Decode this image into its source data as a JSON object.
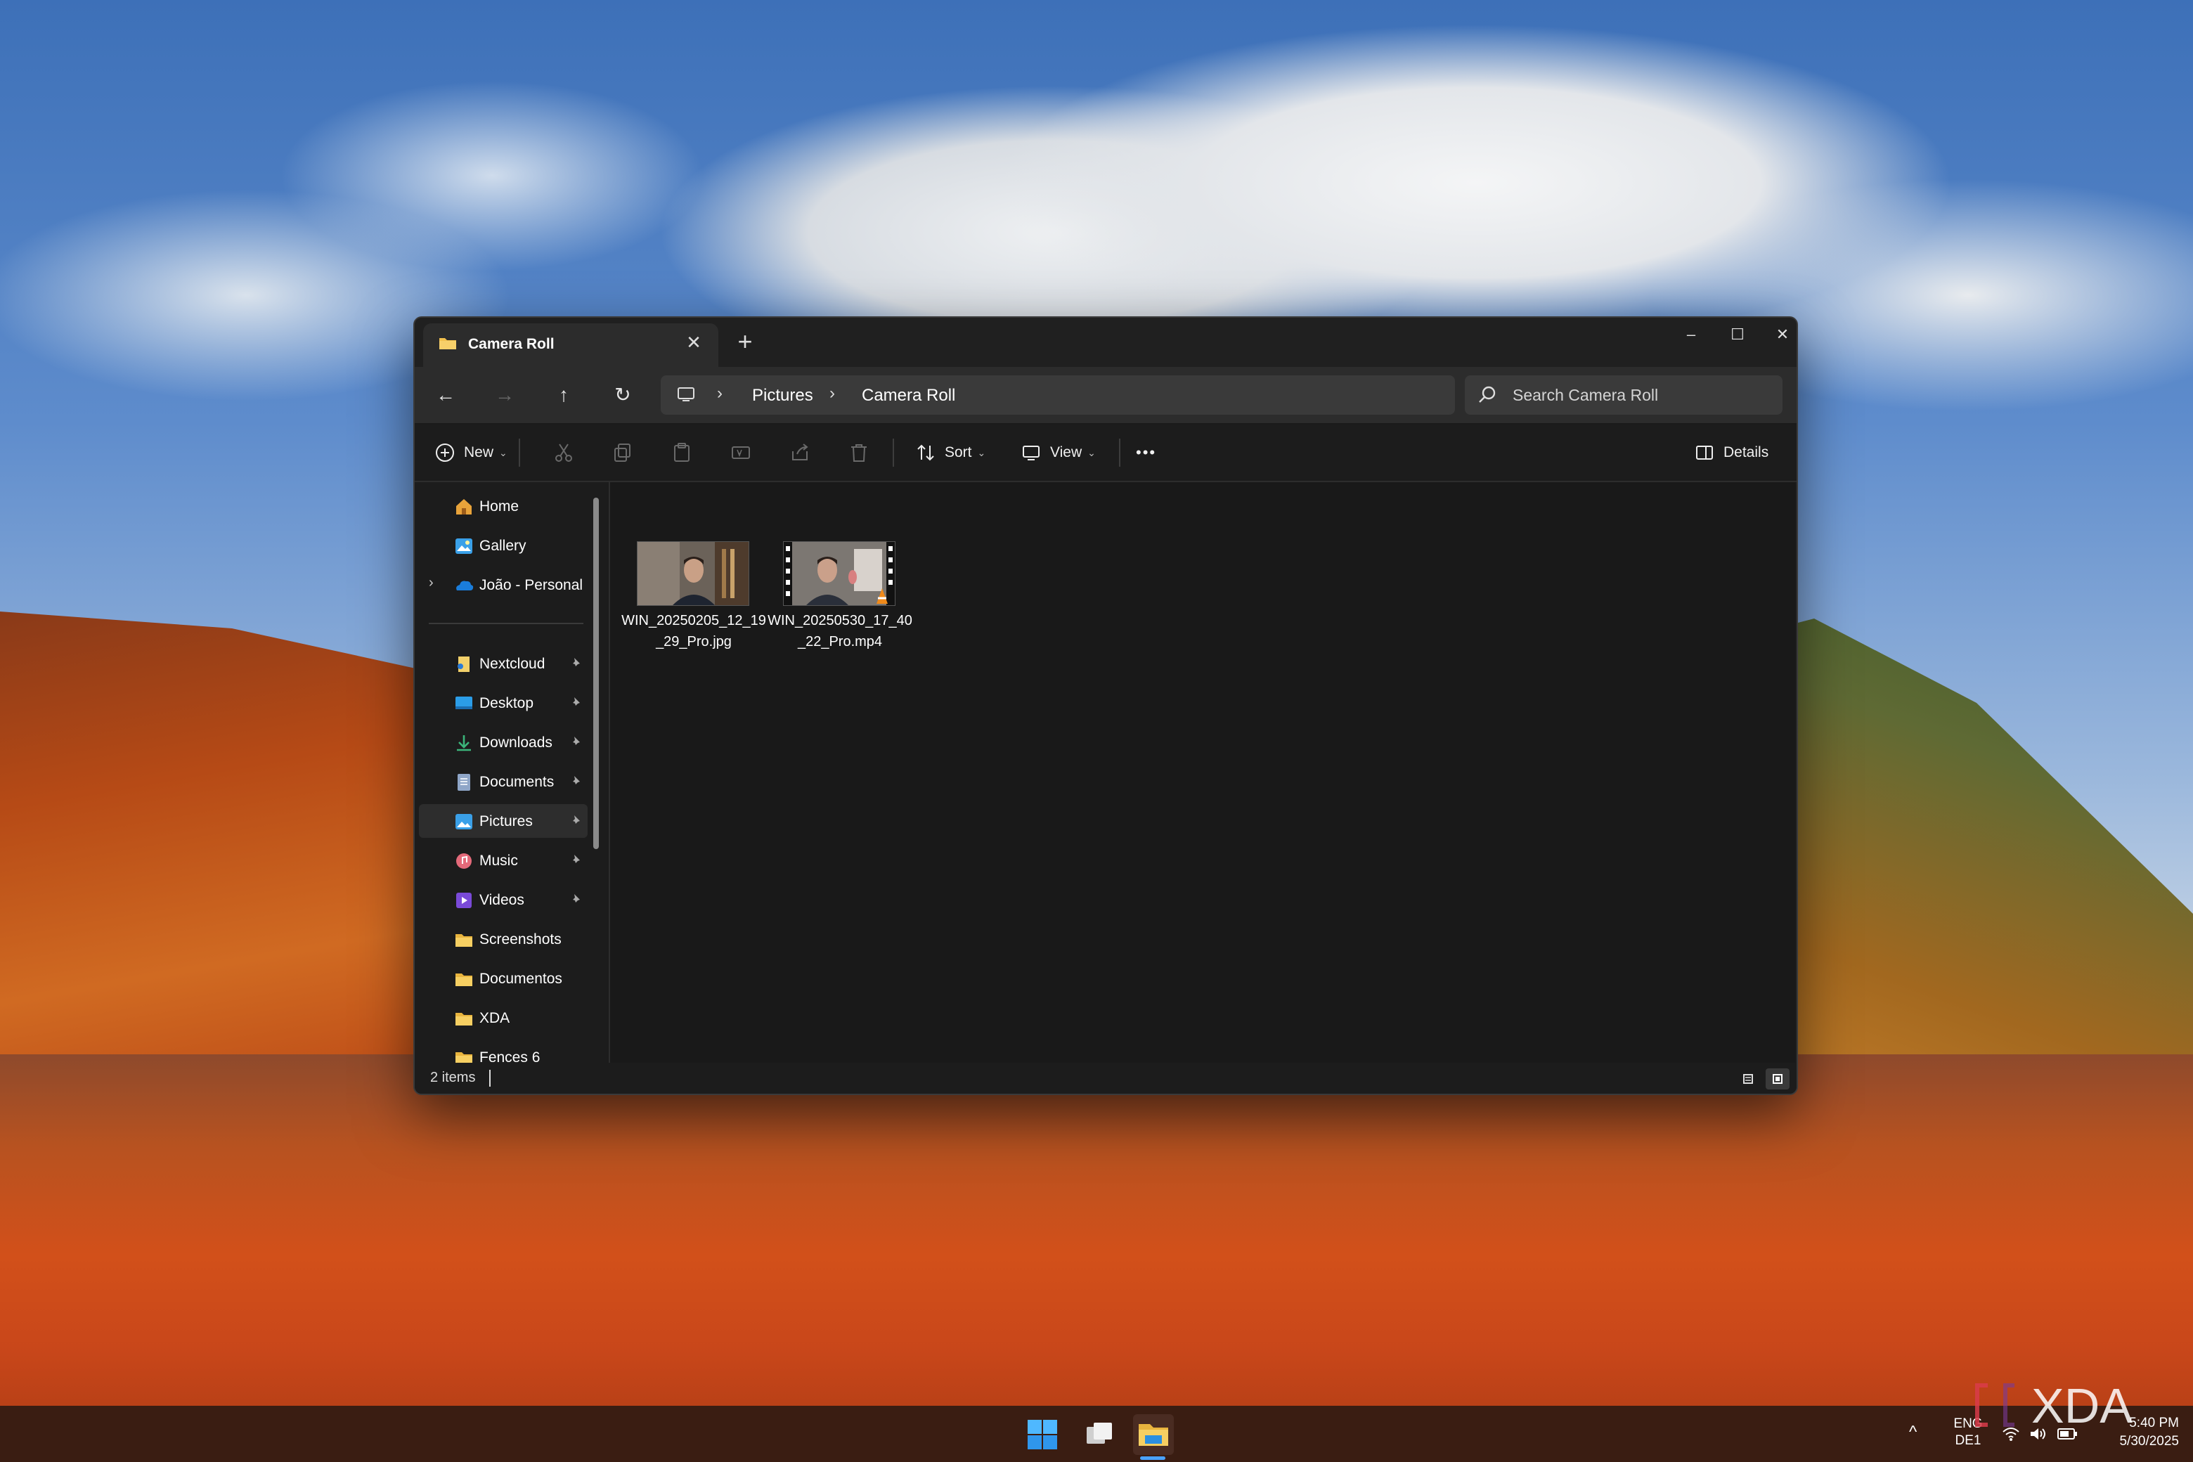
{
  "window": {
    "tab_title": "Camera Roll",
    "tab_close": "✕",
    "new_tab": "+",
    "controls": {
      "minimize": "–",
      "maximize": "☐",
      "close": "✕"
    }
  },
  "navigation": {
    "back": "←",
    "forward": "→",
    "up": "↑",
    "refresh": "↻",
    "breadcrumbs": [
      "Pictures",
      "Camera Roll"
    ],
    "separator": "›",
    "search_placeholder": "Search Camera Roll"
  },
  "toolbar": {
    "new_label": "New",
    "sort_label": "Sort",
    "view_label": "View",
    "more": "•••",
    "details_label": "Details",
    "dropdown_chev": "⌄"
  },
  "sidebar": {
    "expand_glyph": "›",
    "items": [
      {
        "label": "Home",
        "icon": "home-icon"
      },
      {
        "label": "Gallery",
        "icon": "gallery-icon"
      },
      {
        "label": "João - Personal",
        "icon": "onedrive-icon"
      },
      {
        "label": "Nextcloud",
        "icon": "nextcloud-icon",
        "pinned": true
      },
      {
        "label": "Desktop",
        "icon": "desktop-icon",
        "pinned": true
      },
      {
        "label": "Downloads",
        "icon": "downloads-icon",
        "pinned": true
      },
      {
        "label": "Documents",
        "icon": "documents-icon",
        "pinned": true
      },
      {
        "label": "Pictures",
        "icon": "pictures-icon",
        "pinned": true,
        "selected": true
      },
      {
        "label": "Music",
        "icon": "music-icon",
        "pinned": true
      },
      {
        "label": "Videos",
        "icon": "videos-icon",
        "pinned": true
      },
      {
        "label": "Screenshots",
        "icon": "folder-icon"
      },
      {
        "label": "Documentos",
        "icon": "folder-icon"
      },
      {
        "label": "XDA",
        "icon": "folder-icon"
      },
      {
        "label": "Fences 6",
        "icon": "folder-icon"
      }
    ]
  },
  "files": [
    {
      "name": "WIN_20250205_12_19_29_Pro.jpg",
      "type": "image"
    },
    {
      "name": "WIN_20250530_17_40_22_Pro.mp4",
      "type": "video"
    }
  ],
  "status": {
    "item_count": "2 items"
  },
  "taskbar": {
    "tray_chevron": "^",
    "lang_line1": "ENG",
    "lang_line2": "DE1",
    "time": "5:40 PM",
    "date": "5/30/2025"
  },
  "watermark": "XDA",
  "colors": {
    "accent": "#4aa3ff",
    "folder": "#f2c14e",
    "window_bg": "#1c1c1c",
    "taskbar_bg": "#3a1d12"
  }
}
